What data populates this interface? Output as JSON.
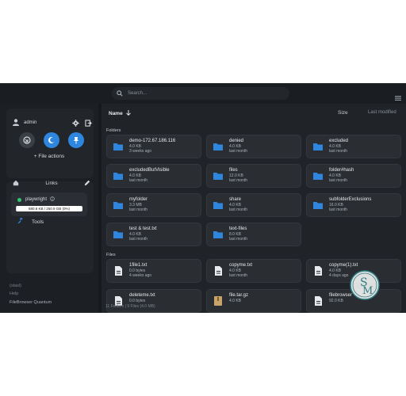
{
  "search": {
    "placeholder": "Search..."
  },
  "user": {
    "name": "admin"
  },
  "sidebar": {
    "file_actions": "+ File actions",
    "links_label": "Links",
    "source": {
      "name": "playwright",
      "usage_text": "680.6 KB / 250.9 GB (0%)",
      "usage_fraction": 0.003
    },
    "tools_label": "Tools",
    "footer": [
      "(stasl)",
      "Help",
      "FileBrowser Quantum"
    ]
  },
  "header": {
    "name_label": "Name",
    "size_label": "Size",
    "modified_label": "Last modified"
  },
  "folders_label": "Folders",
  "files_label": "Files",
  "folders": [
    {
      "name": "demo-172.67.186.116",
      "size": "4.0 KB",
      "date": "3 weeks ago"
    },
    {
      "name": "denied",
      "size": "4.0 KB",
      "date": "last month"
    },
    {
      "name": "excluded",
      "size": "4.0 KB",
      "date": "last month"
    },
    {
      "name": "excludedButVisible",
      "size": "4.0 KB",
      "date": "last month"
    },
    {
      "name": "files",
      "size": "12.0 KB",
      "date": "last month"
    },
    {
      "name": "folder#hash",
      "size": "4.0 KB",
      "date": "last month"
    },
    {
      "name": "myfolder",
      "size": "3.3 MB",
      "date": "last month"
    },
    {
      "name": "share",
      "size": "4.0 KB",
      "date": "last month"
    },
    {
      "name": "subfolderExclusions",
      "size": "16.0 KB",
      "date": "last month"
    },
    {
      "name": "test & test.txt",
      "size": "4.0 KB",
      "date": "last month"
    },
    {
      "name": "text-files",
      "size": "8.0 KB",
      "date": "last month"
    }
  ],
  "files": [
    {
      "name": "1file1.txt",
      "size": "0.0 bytes",
      "date": "4 weeks ago"
    },
    {
      "name": "copyme.txt",
      "size": "4.0 KB",
      "date": "last month"
    },
    {
      "name": "copyme(1).txt",
      "size": "4.0 KB",
      "date": "4 days ago"
    },
    {
      "name": "deleteme.txt",
      "size": "0.0 bytes",
      "date": ""
    },
    {
      "name": "file.tar.gz",
      "size": "4.0 KB",
      "date": ""
    },
    {
      "name": "filebrowser",
      "size": "92.0 KB",
      "date": ""
    }
  ],
  "status_text": "11 Folders | 9 Files (4.0 MB)",
  "colors": {
    "accent": "#2e86de",
    "background": "#16191d",
    "panel": "#202327",
    "card": "#2a2e33"
  }
}
